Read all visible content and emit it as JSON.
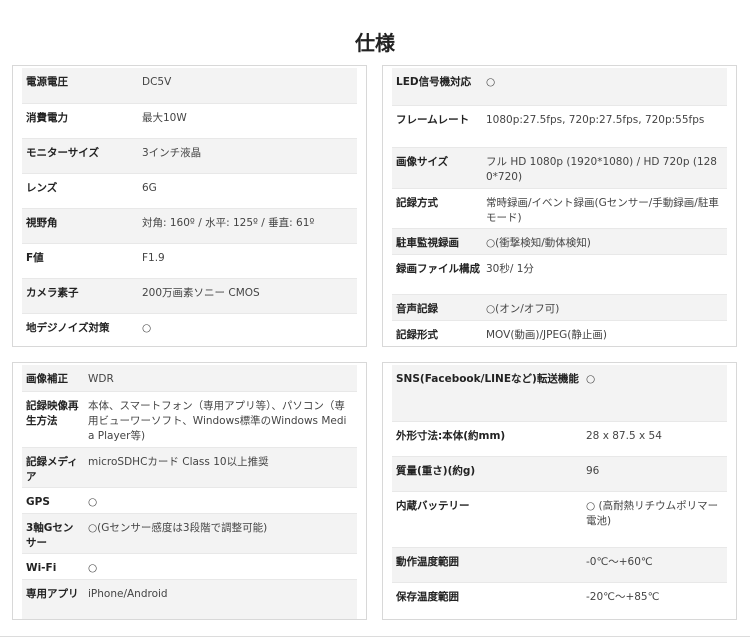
{
  "title": "仕様",
  "tables": [
    {
      "rows": [
        {
          "k": "電源電圧",
          "v": "DC5V"
        },
        {
          "k": "消費電力",
          "v": "最大10W"
        },
        {
          "k": "モニターサイズ",
          "v": "3インチ液晶"
        },
        {
          "k": "レンズ",
          "v": "6G"
        },
        {
          "k": "視野角",
          "v": "対角: 160º / 水平: 125º / 垂直: 61º"
        },
        {
          "k": "F値",
          "v": "F1.9"
        },
        {
          "k": "カメラ素子",
          "v": "200万画素ソニー CMOS"
        },
        {
          "k": "地デジノイズ対策",
          "v": "○"
        }
      ]
    },
    {
      "rows": [
        {
          "k": "LED信号機対応",
          "v": "○"
        },
        {
          "k": "フレームレート",
          "v": "1080p:27.5fps, 720p:27.5fps, 720p:55fps"
        },
        {
          "k": "画像サイズ",
          "v": "フル HD 1080p (1920*1080) / HD 720p (1280*720)"
        },
        {
          "k": "記録方式",
          "v": "常時録画/イベント録画(Gセンサー/手動録画/駐車モード)"
        },
        {
          "k": "駐車監視録画",
          "v": "○(衝撃検知/動体検知)"
        },
        {
          "k": "録画ファイル構成",
          "v": "30秒/ 1分"
        },
        {
          "k": "音声記録",
          "v": "○(オン/オフ可)"
        },
        {
          "k": "記録形式",
          "v": "MOV(動画)/JPEG(静止画)"
        }
      ]
    },
    {
      "rows": [
        {
          "k": "画像補正",
          "v": "WDR"
        },
        {
          "k": "記録映像再生方法",
          "v": "本体、スマートフォン（専用アプリ等）、パソコン（専用ビューワーソフト、Windows標準のWindows Media Player等)"
        },
        {
          "k": "記録メディア",
          "v": "microSDHCカード Class 10以上推奨"
        },
        {
          "k": "GPS",
          "v": "○"
        },
        {
          "k": "3軸Gセンサー",
          "v": "○(Gセンサー感度は3段階で調整可能)"
        },
        {
          "k": "Wi-Fi",
          "v": "○"
        },
        {
          "k": "専用アプリ",
          "v": "iPhone/Android"
        }
      ]
    },
    {
      "rows": [
        {
          "k": "SNS(Facebook/LINEなど)転送機能",
          "v": "○"
        },
        {
          "k": "外形寸法:本体(約mm)",
          "v": "28 x 87.5 x 54"
        },
        {
          "k": "質量(重さ)(約g)",
          "v": "96"
        },
        {
          "k": "内蔵バッテリー",
          "v": "○ (高耐熱リチウムポリマー電池)"
        },
        {
          "k": "動作温度範囲",
          "v": "-0℃～+60℃"
        },
        {
          "k": "保存温度範囲",
          "v": "-20℃～+85℃"
        }
      ]
    }
  ]
}
